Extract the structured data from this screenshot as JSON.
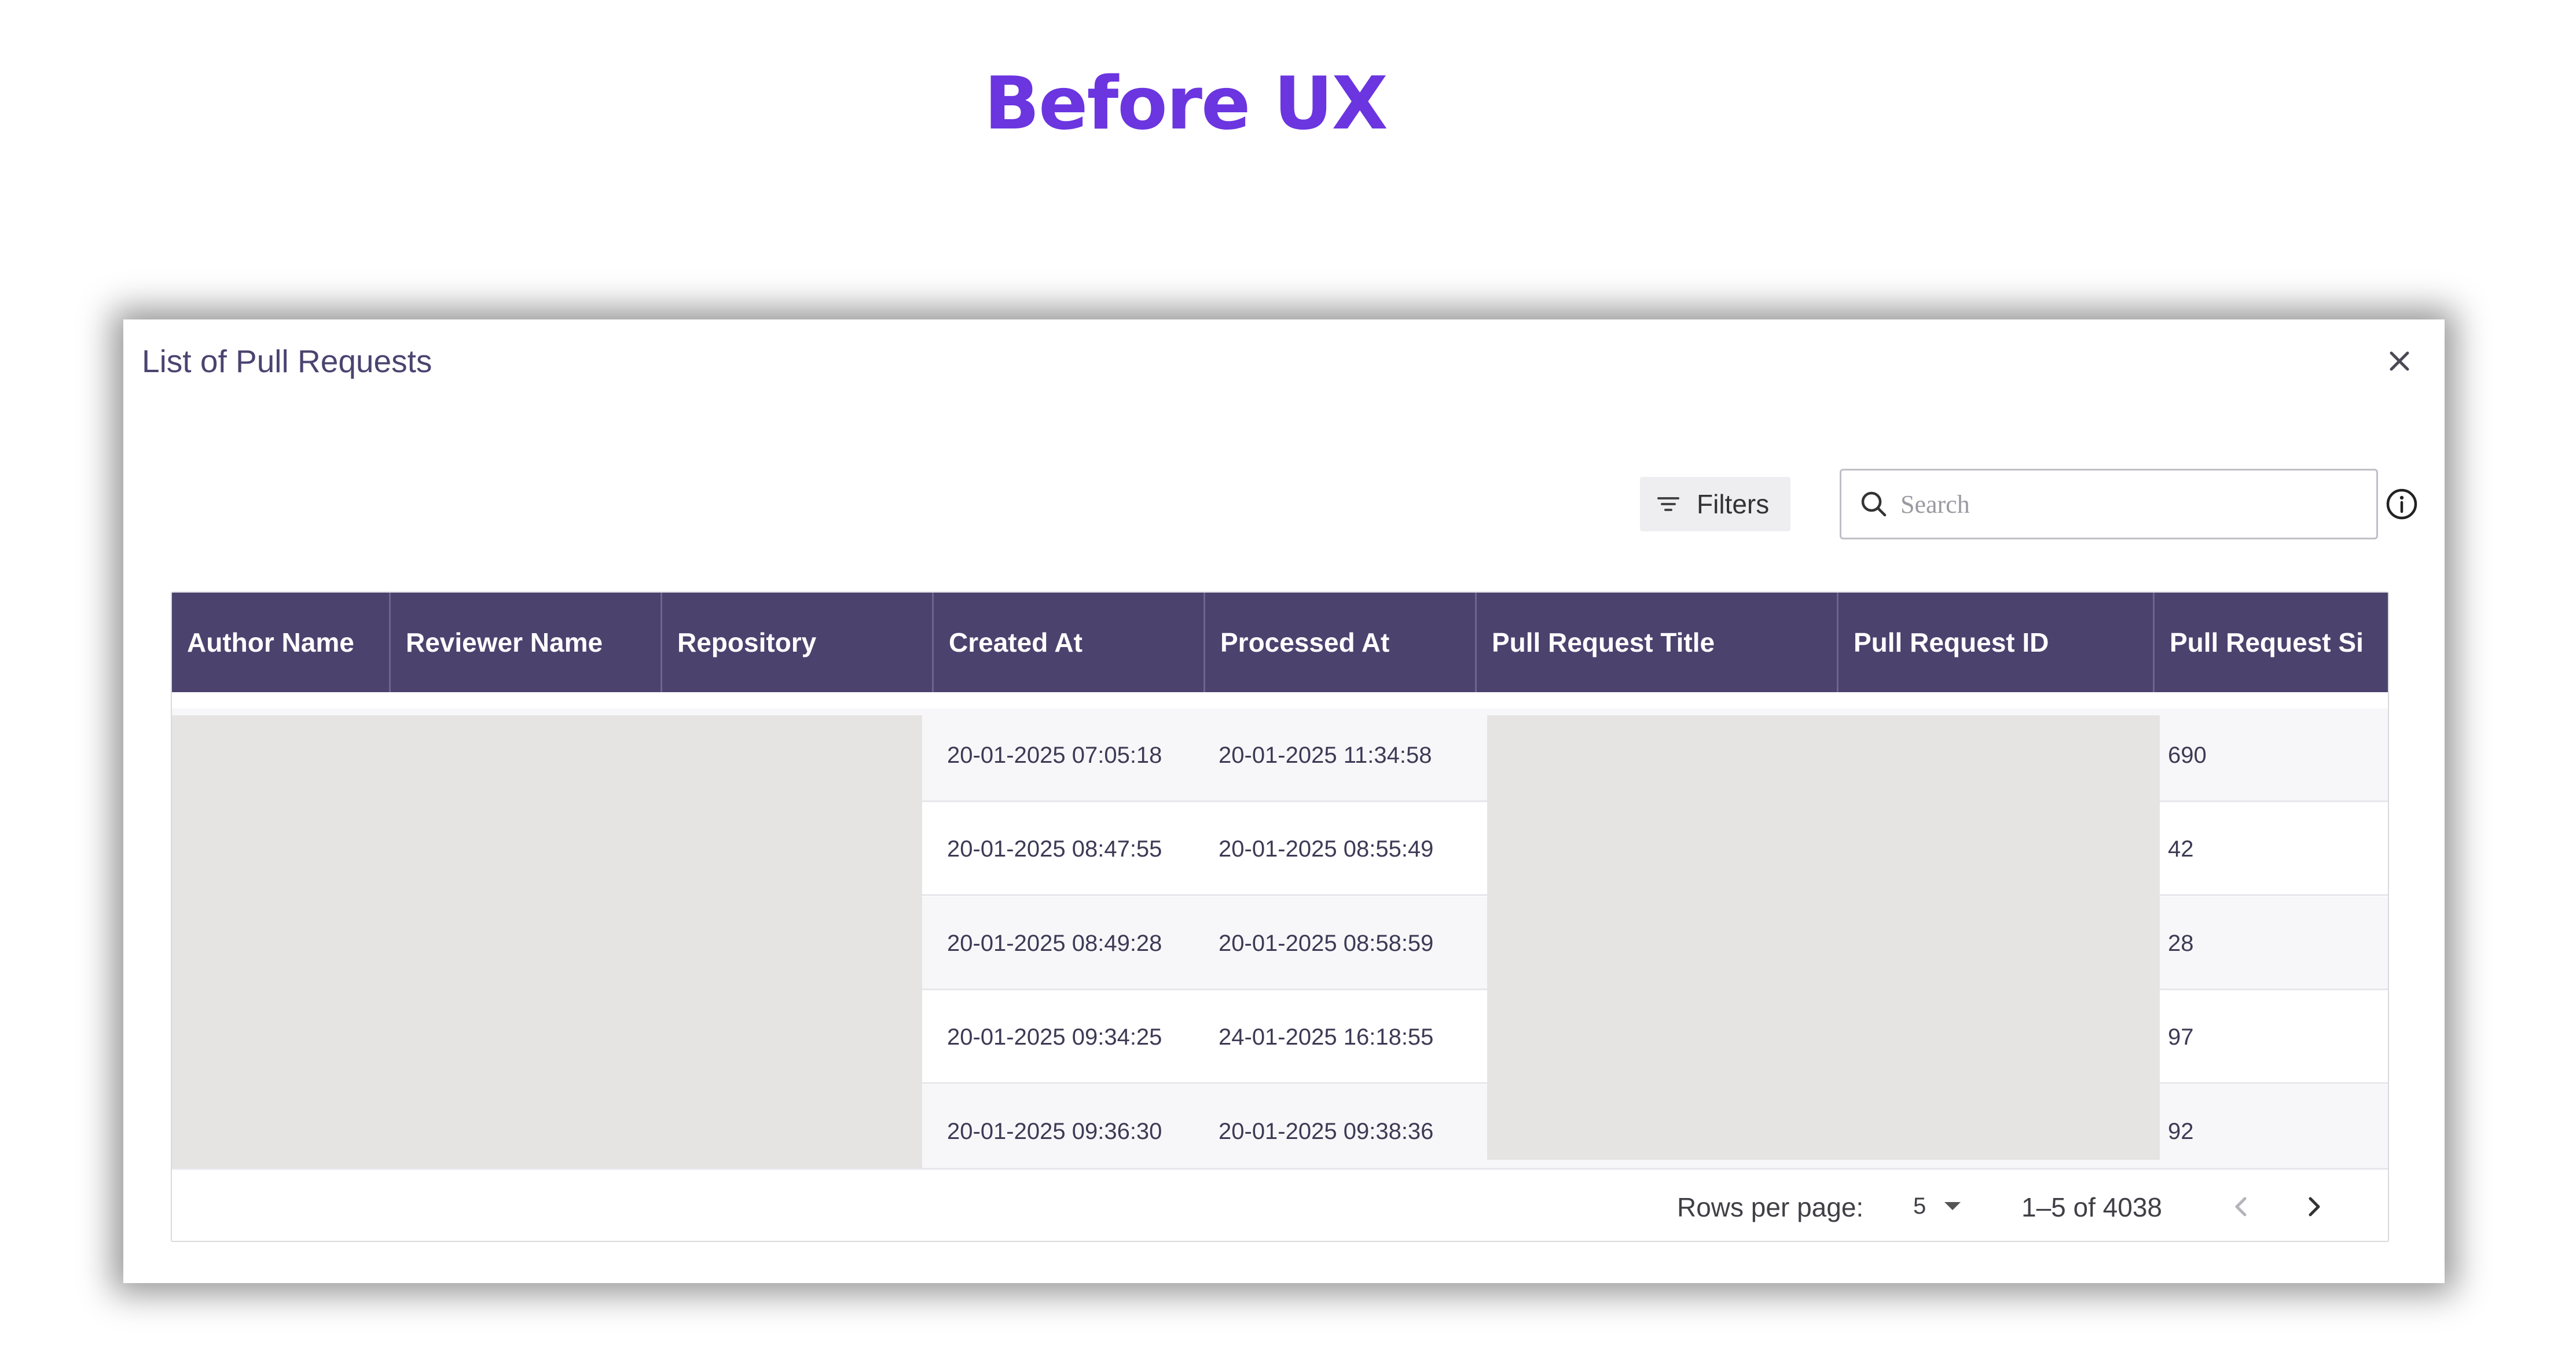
{
  "page": {
    "heading": "Before UX"
  },
  "dialog": {
    "title": "List of Pull Requests",
    "close_icon": "close-icon",
    "toolbar": {
      "filters_label": "Filters",
      "filters_icon": "filter-lines-icon",
      "search_placeholder": "Search",
      "search_value": "",
      "search_icon": "search-icon",
      "info_icon": "info-circle-icon"
    }
  },
  "table": {
    "columns": [
      "Author Name",
      "Reviewer Name",
      "Repository",
      "Created At",
      "Processed At",
      "Pull Request Title",
      "Pull Request ID",
      "Pull Request Si"
    ],
    "rows": [
      {
        "created_at": "20-01-2025 07:05:18",
        "processed_at": "20-01-2025 11:34:58",
        "pr_size": "690"
      },
      {
        "created_at": "20-01-2025 08:47:55",
        "processed_at": "20-01-2025 08:55:49",
        "pr_size": "42"
      },
      {
        "created_at": "20-01-2025 08:49:28",
        "processed_at": "20-01-2025 08:58:59",
        "pr_size": "28"
      },
      {
        "created_at": "20-01-2025 09:34:25",
        "processed_at": "24-01-2025 16:18:55",
        "pr_size": "97"
      },
      {
        "created_at": "20-01-2025 09:36:30",
        "processed_at": "20-01-2025 09:38:36",
        "pr_size": "92"
      }
    ],
    "redacted_columns": [
      "Author Name",
      "Reviewer Name",
      "Repository",
      "Pull Request Title",
      "Pull Request ID"
    ]
  },
  "pagination": {
    "rows_per_page_label": "Rows per page:",
    "rows_per_page_value": "5",
    "range": "1–5 of 4038",
    "prev_icon": "chevron-left-icon",
    "next_icon": "chevron-right-icon"
  },
  "colors": {
    "heading": "#6b35e0",
    "header_bg": "#4b426e",
    "redaction": "#e5e4e3"
  }
}
